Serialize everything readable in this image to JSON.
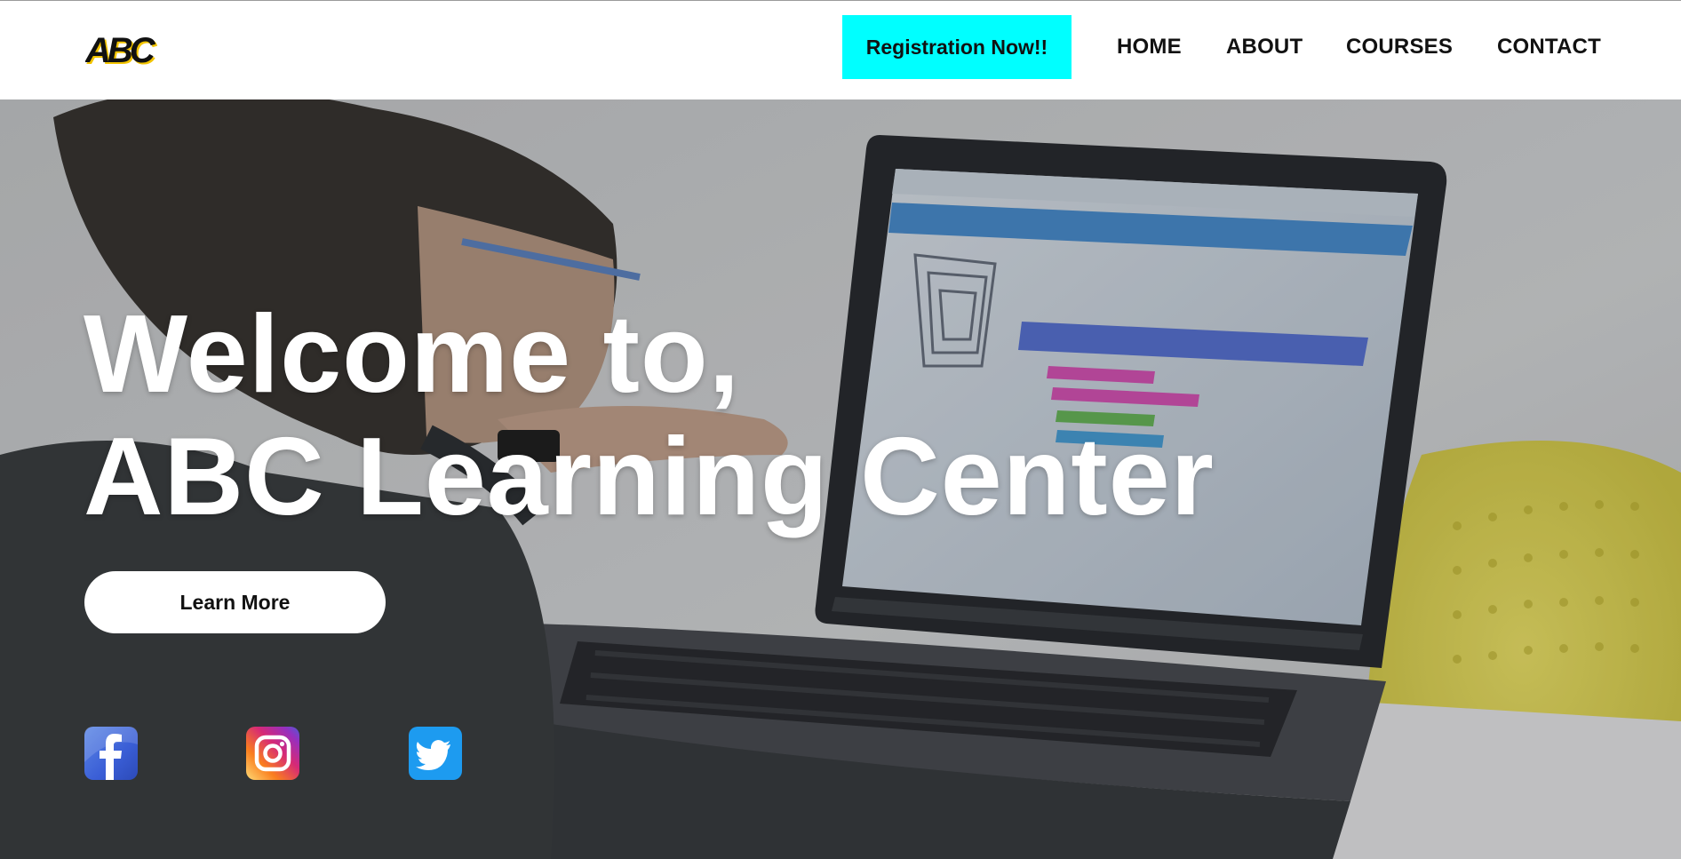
{
  "brand": {
    "logo_text": "ABC"
  },
  "header": {
    "cta_label": "Registration Now!!",
    "nav": [
      {
        "label": "HOME"
      },
      {
        "label": "ABOUT"
      },
      {
        "label": "COURSES"
      },
      {
        "label": "CONTACT"
      }
    ]
  },
  "hero": {
    "title_line1": "Welcome to,",
    "title_line2": "ABC Learning Center",
    "button_label": "Learn More",
    "background_image": "child-using-laptop-photo"
  },
  "social": [
    {
      "name": "facebook-icon"
    },
    {
      "name": "instagram-icon"
    },
    {
      "name": "twitter-icon"
    }
  ],
  "colors": {
    "cta_background": "#00ffff",
    "nav_text": "#111111",
    "hero_text": "#ffffff",
    "button_background": "#ffffff"
  }
}
